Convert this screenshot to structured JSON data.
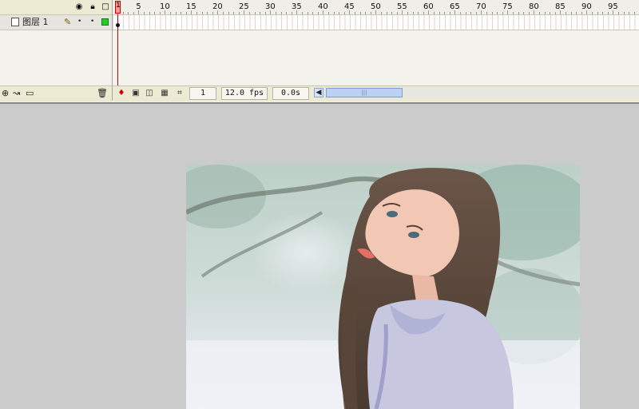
{
  "timeline": {
    "layer_name": "图层 1",
    "frame_numbers": [
      "1",
      "5",
      "10",
      "15",
      "20",
      "25",
      "30",
      "35",
      "40",
      "45",
      "50",
      "55",
      "60",
      "65",
      "70",
      "75",
      "80",
      "85",
      "90",
      "95"
    ]
  },
  "bottom_bar": {
    "current_frame": "1",
    "fps": "12.0 fps",
    "time": "0.0s"
  },
  "icons": {
    "eye": "eye-icon",
    "lock": "lock-icon",
    "outline": "outline-icon",
    "pencil": "pencil-icon",
    "trash": "trash-icon"
  },
  "colors": {
    "playhead": "#cc0000",
    "layer_outline": "#22cc22",
    "scrollbar": "#bcd1f4",
    "stage_bg": "#cbcbcb"
  }
}
